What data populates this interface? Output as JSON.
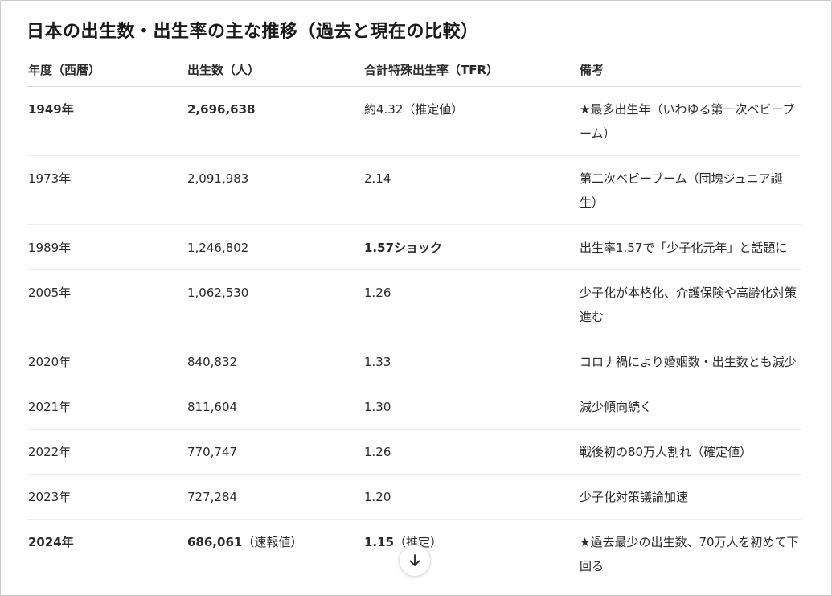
{
  "title": "日本の出生数・出生率の主な推移（過去と現在の比較）",
  "headers": {
    "year": "年度（西暦）",
    "births": "出生数（人）",
    "tfr": "合計特殊出生率（TFR）",
    "note": "備考"
  },
  "rows": [
    {
      "year": "1949年",
      "births": "2,696,638",
      "births_note": "",
      "tfr": "約4.32（推定値）",
      "tfr_note": "",
      "note": "★最多出生年（いわゆる第一次ベビーブーム）"
    },
    {
      "year": "1973年",
      "births": "2,091,983",
      "births_note": "",
      "tfr": "2.14",
      "tfr_note": "",
      "note": "第二次ベビーブーム（団塊ジュニア誕生）"
    },
    {
      "year": "1989年",
      "births": "1,246,802",
      "births_note": "",
      "tfr": "1.57ショック",
      "tfr_note": "",
      "note": "出生率1.57で「少子化元年」と話題に"
    },
    {
      "year": "2005年",
      "births": "1,062,530",
      "births_note": "",
      "tfr": "1.26",
      "tfr_note": "",
      "note": "少子化が本格化、介護保険や高齢化対策進む"
    },
    {
      "year": "2020年",
      "births": "840,832",
      "births_note": "",
      "tfr": "1.33",
      "tfr_note": "",
      "note": "コロナ禍により婚姻数・出生数とも減少"
    },
    {
      "year": "2021年",
      "births": "811,604",
      "births_note": "",
      "tfr": "1.30",
      "tfr_note": "",
      "note": "減少傾向続く"
    },
    {
      "year": "2022年",
      "births": "770,747",
      "births_note": "",
      "tfr": "1.26",
      "tfr_note": "",
      "note": "戦後初の80万人割れ（確定値）"
    },
    {
      "year": "2023年",
      "births": "727,284",
      "births_note": "",
      "tfr": "1.20",
      "tfr_note": "",
      "note": "少子化対策議論加速"
    },
    {
      "year": "2024年",
      "births": "686,061",
      "births_note": "（速報値）",
      "tfr": "1.15",
      "tfr_note": "（推定）",
      "note": "★過去最少の出生数、70万人を初めて下回る"
    }
  ],
  "scroll_icon": "arrow-down-icon"
}
